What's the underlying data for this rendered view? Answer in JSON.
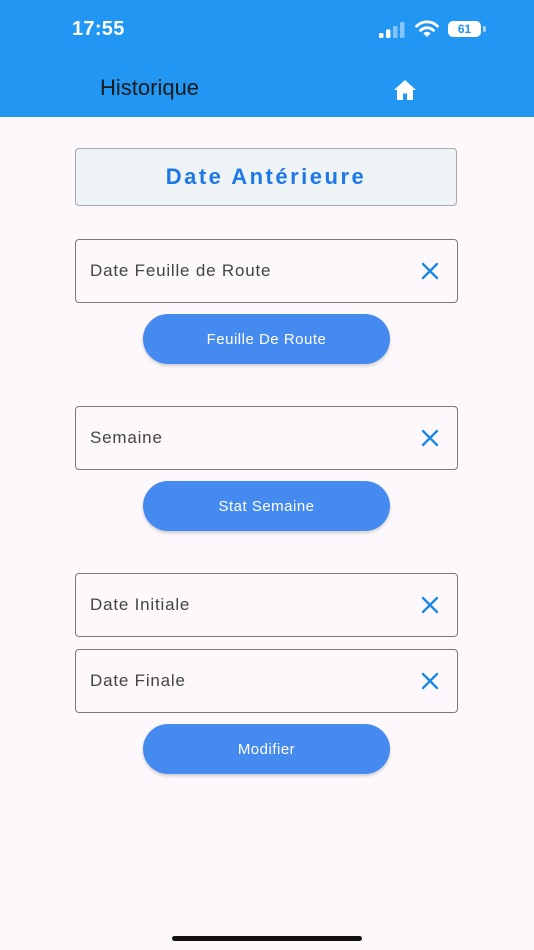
{
  "status_bar": {
    "time": "17:55",
    "battery": "61"
  },
  "app_bar": {
    "title": "Historique",
    "home_icon": "home-icon"
  },
  "header": {
    "label": "Date Antérieure"
  },
  "fields": {
    "feuille": {
      "label": "Date Feuille de Route"
    },
    "semaine": {
      "label": "Semaine"
    },
    "initiale": {
      "label": "Date Initiale"
    },
    "finale": {
      "label": "Date Finale"
    }
  },
  "buttons": {
    "feuille": "Feuille De Route",
    "semaine": "Stat Semaine",
    "modifier": "Modifier"
  },
  "colors": {
    "app_bar": "#2196f3",
    "accent_text": "#1e78e8",
    "button": "#448aef",
    "clear_icon": "#1e88e5"
  }
}
